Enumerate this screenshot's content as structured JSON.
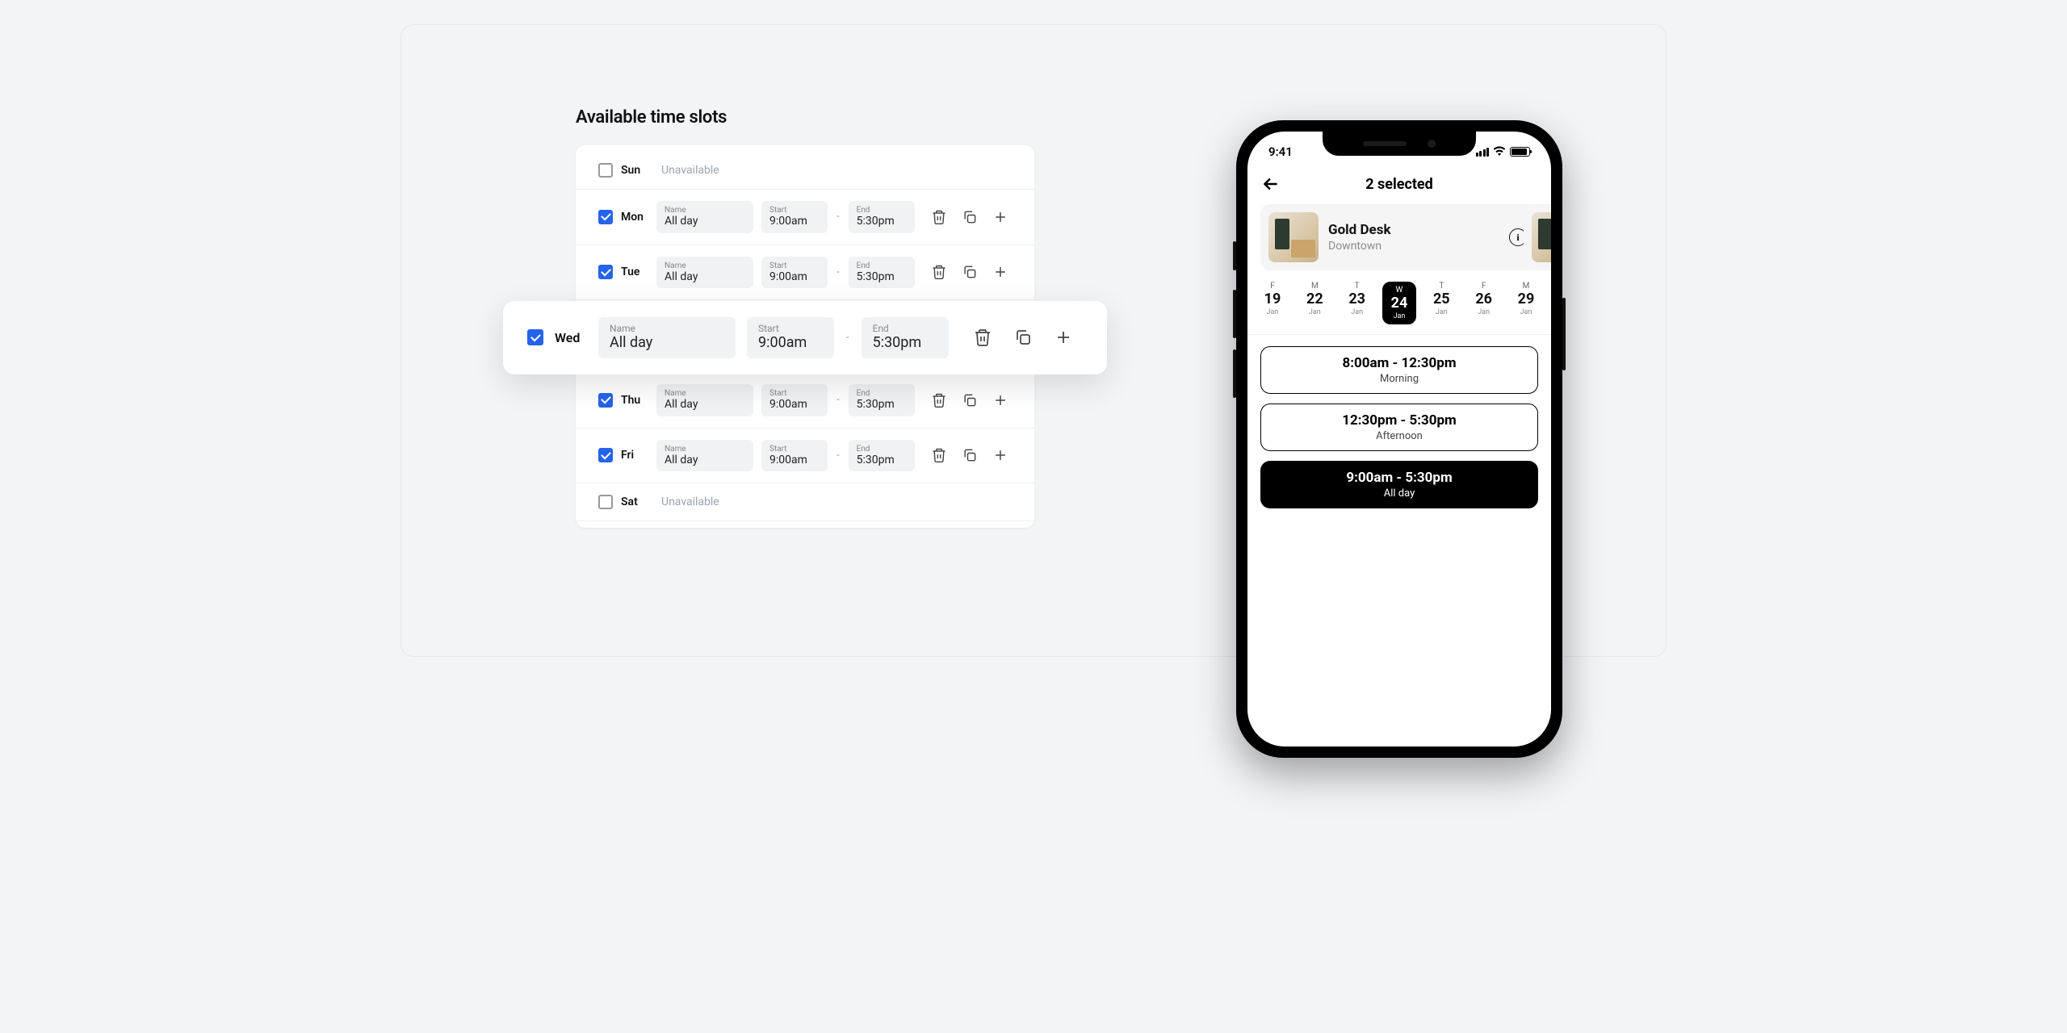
{
  "timeslots": {
    "title": "Available time slots",
    "labels": {
      "name": "Name",
      "start": "Start",
      "end": "End",
      "dash": "-"
    },
    "unavailable_text": "Unavailable",
    "days": [
      {
        "abbr": "Sun",
        "enabled": false
      },
      {
        "abbr": "Mon",
        "enabled": true,
        "name": "All day",
        "start": "9:00am",
        "end": "5:30pm"
      },
      {
        "abbr": "Tue",
        "enabled": true,
        "name": "All day",
        "start": "9:00am",
        "end": "5:30pm"
      },
      {
        "abbr": "Wed",
        "enabled": true,
        "name": "All day",
        "start": "9:00am",
        "end": "5:30pm",
        "highlighted": true
      },
      {
        "abbr": "Thu",
        "enabled": true,
        "name": "All day",
        "start": "9:00am",
        "end": "5:30pm"
      },
      {
        "abbr": "Fri",
        "enabled": true,
        "name": "All day",
        "start": "9:00am",
        "end": "5:30pm"
      },
      {
        "abbr": "Sat",
        "enabled": false
      }
    ]
  },
  "mobile": {
    "status_time": "9:41",
    "header_title": "2 selected",
    "resource": {
      "name": "Gold Desk",
      "location": "Downtown"
    },
    "info_glyph": "i",
    "dates": [
      {
        "dow": "F",
        "num": "19",
        "mon": "Jan",
        "selected": false
      },
      {
        "dow": "M",
        "num": "22",
        "mon": "Jan",
        "selected": false
      },
      {
        "dow": "T",
        "num": "23",
        "mon": "Jan",
        "selected": false
      },
      {
        "dow": "W",
        "num": "24",
        "mon": "Jan",
        "selected": true
      },
      {
        "dow": "T",
        "num": "25",
        "mon": "Jan",
        "selected": false
      },
      {
        "dow": "F",
        "num": "26",
        "mon": "Jan",
        "selected": false
      },
      {
        "dow": "M",
        "num": "29",
        "mon": "Jan",
        "selected": false
      }
    ],
    "slots": [
      {
        "time": "8:00am - 12:30pm",
        "name": "Morning",
        "selected": false
      },
      {
        "time": "12:30pm - 5:30pm",
        "name": "Afternoon",
        "selected": false
      },
      {
        "time": "9:00am - 5:30pm",
        "name": "All day",
        "selected": true
      }
    ]
  },
  "colors": {
    "accent": "#2563eb"
  }
}
